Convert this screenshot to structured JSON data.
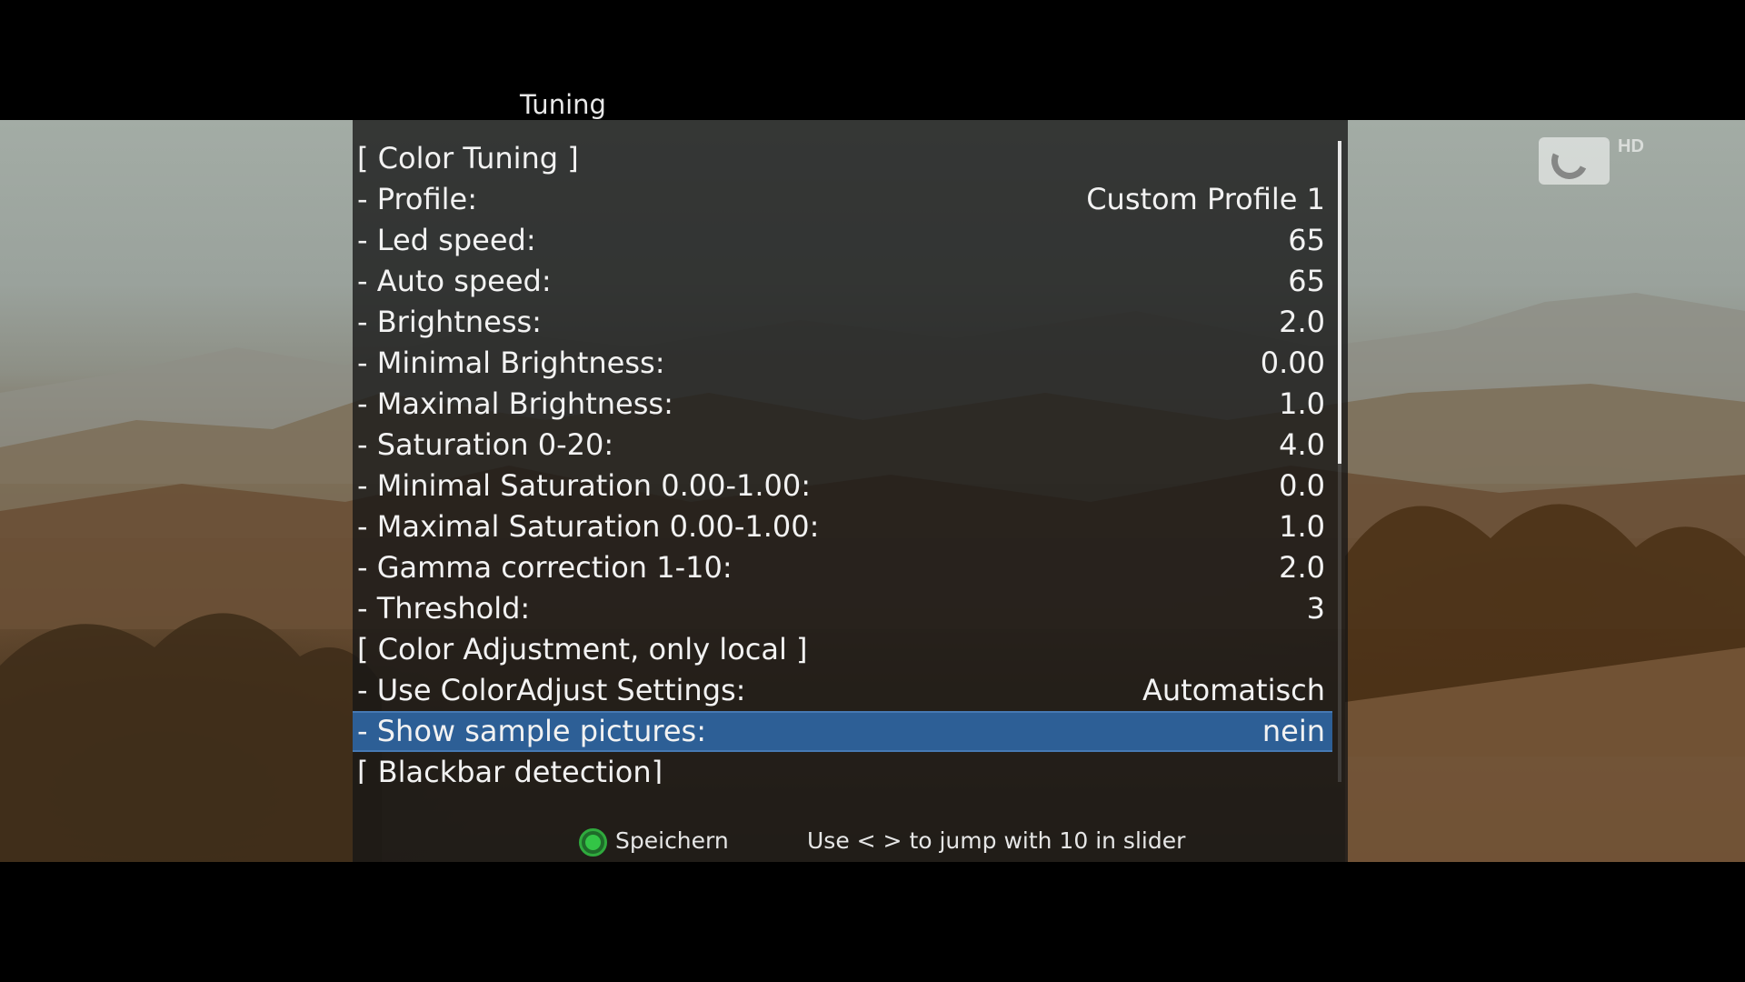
{
  "window": {
    "title": "Tuning"
  },
  "channel": {
    "logo_icon": "channel-swirl-logo",
    "badge": "HD"
  },
  "menu": {
    "rows": [
      {
        "label": "[ Color Tuning ]",
        "value": "",
        "kind": "section"
      },
      {
        "label": "- Profile:",
        "value": "Custom Profile 1",
        "kind": "option"
      },
      {
        "label": "- Led speed:",
        "value": "65",
        "kind": "option"
      },
      {
        "label": "- Auto speed:",
        "value": "65",
        "kind": "option"
      },
      {
        "label": "- Brightness:",
        "value": "2.0",
        "kind": "option"
      },
      {
        "label": "- Minimal Brightness:",
        "value": "0.00",
        "kind": "option"
      },
      {
        "label": "- Maximal Brightness:",
        "value": "1.0",
        "kind": "option"
      },
      {
        "label": "- Saturation 0-20:",
        "value": "4.0",
        "kind": "option"
      },
      {
        "label": "- Minimal Saturation 0.00-1.00:",
        "value": "0.0",
        "kind": "option"
      },
      {
        "label": "- Maximal Saturation 0.00-1.00:",
        "value": "1.0",
        "kind": "option"
      },
      {
        "label": "- Gamma correction 1-10:",
        "value": "2.0",
        "kind": "option"
      },
      {
        "label": "- Threshold:",
        "value": "3",
        "kind": "option"
      },
      {
        "label": "[ Color Adjustment, only local ]",
        "value": "",
        "kind": "section"
      },
      {
        "label": "- Use ColorAdjust Settings:",
        "value": "Automatisch",
        "kind": "option"
      },
      {
        "label": "- Show sample pictures:",
        "value": "nein",
        "kind": "option",
        "selected": true
      },
      {
        "label": "[ Blackbar detection]",
        "value": "",
        "kind": "section"
      }
    ],
    "selected_index": 14,
    "scroll_fraction": 0.5
  },
  "footer": {
    "green_button_icon": "green-circle-icon",
    "green_label": "Speichern",
    "hint": "Use < > to jump with 10 in slider"
  },
  "colors": {
    "selection": "#2d5f96",
    "panel": "#161616",
    "text": "#f2f2f2",
    "green_key": "#33c546"
  }
}
